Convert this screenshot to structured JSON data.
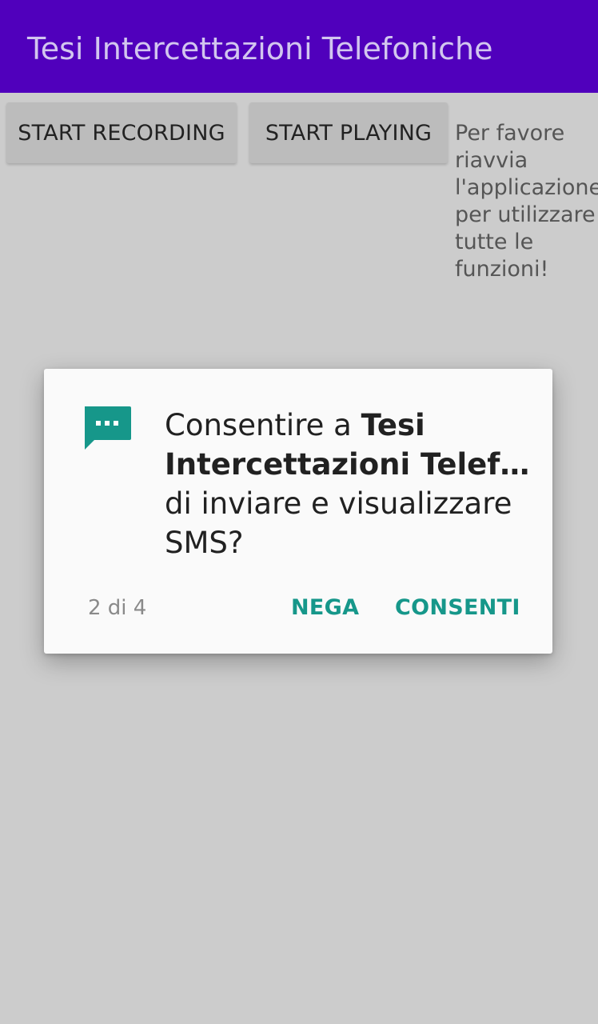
{
  "app": {
    "title": "Tesi Intercettazioni Telefoniche"
  },
  "buttons": {
    "start_recording": "START RECORDING",
    "start_playing": "START PLAYING"
  },
  "notice": {
    "lines": [
      "Per favore",
      "riavvia",
      "l'applicazione",
      "per utilizzare",
      "tutte le",
      "funzioni!"
    ]
  },
  "permission_dialog": {
    "icon": "sms-icon",
    "message_prefix": "Consentire a ",
    "app_name_line1": "Tesi",
    "app_name_line2": "Intercettazioni Telef…",
    "message_line3": "di inviare e visualizzare",
    "message_line4": "SMS?",
    "counter": "2 di 4",
    "deny_label": "NEGA",
    "allow_label": "CONSENTI"
  },
  "colors": {
    "appbar": "#5000bc",
    "title_text": "#d2c6ef",
    "accent": "#16978a",
    "background": "#cccccc",
    "button": "#bcbcbc"
  }
}
